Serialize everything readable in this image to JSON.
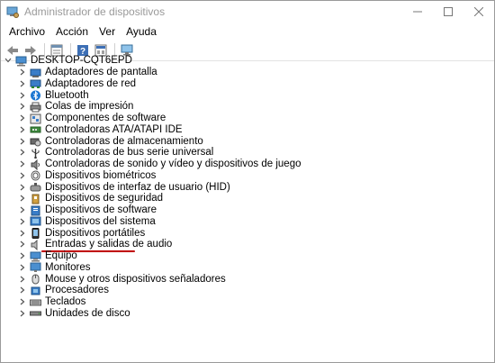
{
  "window": {
    "title": "Administrador de dispositivos",
    "controls": [
      "minimize-icon",
      "maximize-icon",
      "close-icon"
    ]
  },
  "menu": [
    {
      "label": "Archivo"
    },
    {
      "label": "Acción"
    },
    {
      "label": "Ver"
    },
    {
      "label": "Ayuda"
    }
  ],
  "toolbar": {
    "buttons": [
      "back-arrow-icon",
      "forward-arrow-icon",
      "properties-icon",
      "help-icon",
      "view-icon",
      "monitor-scan-icon"
    ]
  },
  "tree": {
    "root": {
      "label": "DESKTOP-CQT6EPD",
      "icon": "computer-icon",
      "expanded": true
    },
    "items": [
      {
        "label": "Adaptadores de pantalla",
        "icon": "display-adapter-icon"
      },
      {
        "label": "Adaptadores de red",
        "icon": "network-adapter-icon"
      },
      {
        "label": "Bluetooth",
        "icon": "bluetooth-icon"
      },
      {
        "label": "Colas de impresión",
        "icon": "printer-icon"
      },
      {
        "label": "Componentes de software",
        "icon": "software-component-icon"
      },
      {
        "label": "Controladoras ATA/ATAPI IDE",
        "icon": "ide-controller-icon"
      },
      {
        "label": "Controladoras de almacenamiento",
        "icon": "storage-controller-icon"
      },
      {
        "label": "Controladoras de bus serie universal",
        "icon": "usb-icon"
      },
      {
        "label": "Controladoras de sonido y vídeo y dispositivos de juego",
        "icon": "sound-icon"
      },
      {
        "label": "Dispositivos biométricos",
        "icon": "biometric-icon"
      },
      {
        "label": "Dispositivos de interfaz de usuario (HID)",
        "icon": "hid-icon"
      },
      {
        "label": "Dispositivos de seguridad",
        "icon": "security-device-icon"
      },
      {
        "label": "Dispositivos de software",
        "icon": "software-device-icon"
      },
      {
        "label": "Dispositivos del sistema",
        "icon": "system-device-icon"
      },
      {
        "label": "Dispositivos portátiles",
        "icon": "portable-device-icon"
      },
      {
        "label": "Entradas y salidas de audio",
        "icon": "speaker-icon",
        "underlined": true
      },
      {
        "label": "Equipo",
        "icon": "computer-icon"
      },
      {
        "label": "Monitores",
        "icon": "monitor-icon"
      },
      {
        "label": "Mouse y otros dispositivos señaladores",
        "icon": "mouse-icon"
      },
      {
        "label": "Procesadores",
        "icon": "processor-icon"
      },
      {
        "label": "Teclados",
        "icon": "keyboard-icon"
      },
      {
        "label": "Unidades de disco",
        "icon": "disk-drive-icon"
      }
    ]
  },
  "colors": {
    "highlight_underline": "#c00000",
    "accent_blue": "#1e78d2"
  }
}
